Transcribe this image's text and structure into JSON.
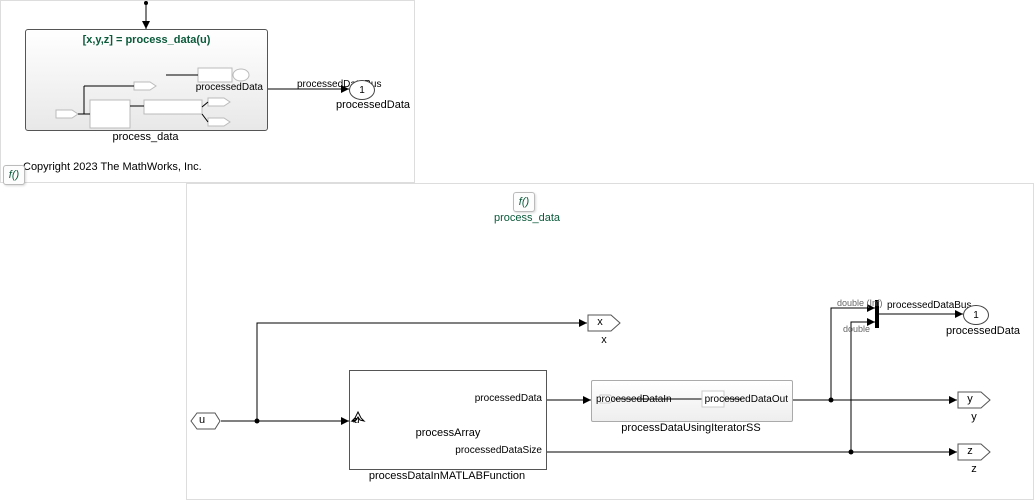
{
  "top": {
    "funcTitle": "[x,y,z] = process_data(u)",
    "blockName": "process_data",
    "outSignal": "processedData",
    "outBusLabel": "processedDataBus",
    "outPortLabel": "processedData",
    "outPortNum": "1",
    "copyright": "Copyright 2023 The MathWorks, Inc.",
    "badge": "f()"
  },
  "bottom": {
    "topBadge": "f()",
    "topTitle": "process_data",
    "inPort": "u",
    "gotoX": "x",
    "gotoXName": "x",
    "gotoY": "y",
    "gotoYName": "y",
    "gotoZ": "z",
    "gotoZName": "z",
    "matlabFn": {
      "inPort": "u",
      "title": "processArray",
      "out1": "processedData",
      "out2": "processedDataSize",
      "name": "processDataInMATLABFunction"
    },
    "iter": {
      "inPort": "processedDataIn",
      "outPort": "processedDataOut",
      "name": "processDataUsingIteratorSS"
    },
    "busLabel": "processedDataBus",
    "doubleInf": "double (Inf)",
    "double": "double",
    "outPortNum": "1",
    "outPortName": "processedData"
  }
}
